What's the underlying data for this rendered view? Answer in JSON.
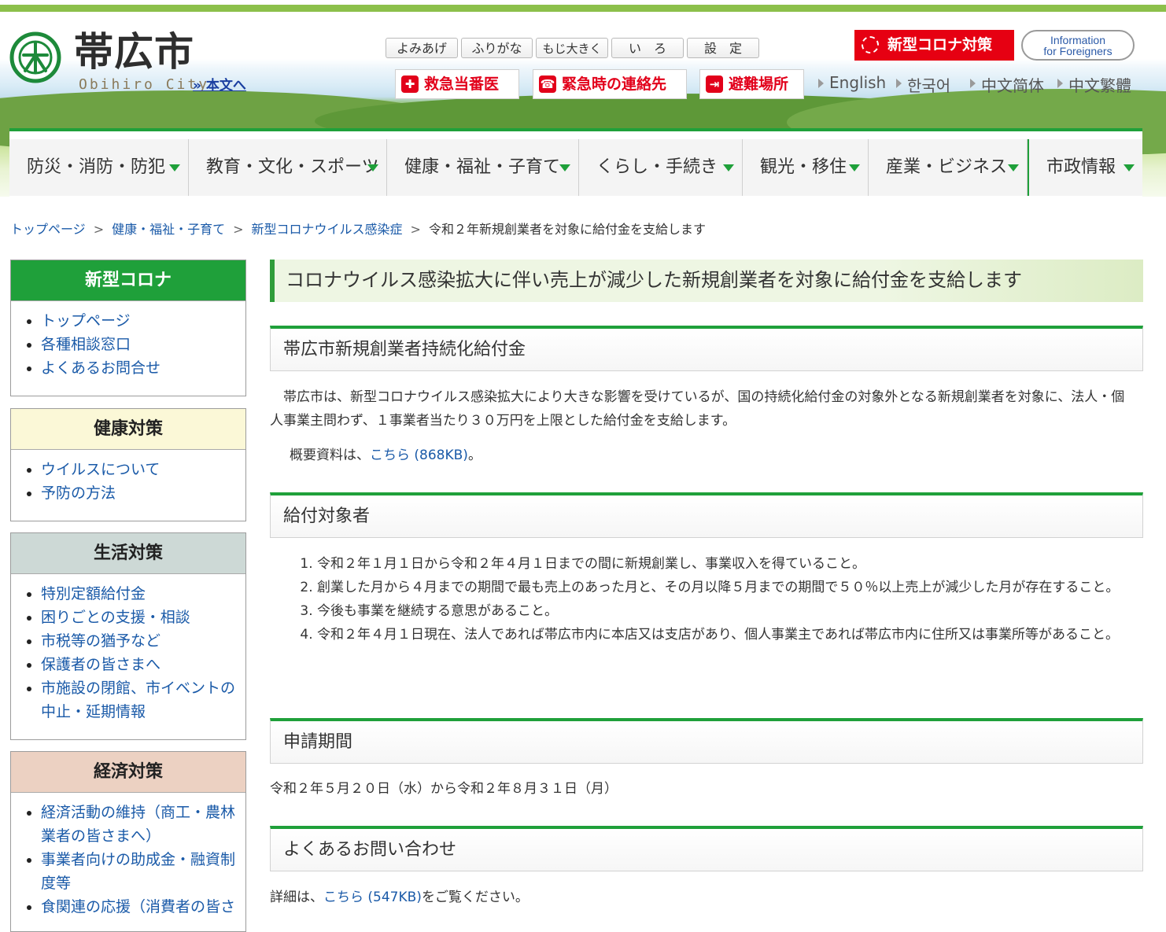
{
  "header": {
    "site_title": "帯広市",
    "site_sub": "Obihiro City",
    "skip_link": "» 本文へ",
    "tools": [
      "よみあげ",
      "ふりがな",
      "もじ大きく",
      "い　ろ",
      "設　定"
    ],
    "covid_button": "新型コロナ対策",
    "foreign_line1": "Information",
    "foreign_line2": "for Foreigners",
    "emergency": [
      "救急当番医",
      "緊急時の連絡先",
      "避難場所"
    ],
    "languages": [
      "English",
      "한국어",
      "中文简体",
      "中文繁體"
    ]
  },
  "global_nav": [
    "防災・消防・防犯",
    "教育・文化・スポーツ",
    "健康・福祉・子育て",
    "くらし・手続き",
    "観光・移住",
    "産業・ビジネス",
    "市政情報"
  ],
  "breadcrumb": {
    "links": [
      "トップページ",
      "健康・福祉・子育て",
      "新型コロナウイルス感染症"
    ],
    "current": "令和２年新規創業者を対象に給付金を支給します",
    "separator": ">"
  },
  "sidebar": [
    {
      "title": "新型コロナ",
      "items": [
        "トップページ",
        "各種相談窓口",
        "よくあるお問合せ"
      ]
    },
    {
      "title": "健康対策",
      "items": [
        "ウイルスについて",
        "予防の方法"
      ]
    },
    {
      "title": "生活対策",
      "items": [
        "特別定額給付金",
        "困りごとの支援・相談",
        "市税等の猶予など",
        "保護者の皆さまへ",
        "市施設の閉館、市イベントの中止・延期情報"
      ]
    },
    {
      "title": "経済対策",
      "items": [
        "経済活動の維持（商工・農林業者の皆さまへ）",
        "事業者向けの助成金・融資制度等",
        "食関連の応援（消費者の皆さ"
      ]
    }
  ],
  "main": {
    "title": "コロナウイルス感染拡大に伴い売上が減少した新規創業者を対象に給付金を支給します",
    "sec1_heading": "帯広市新規創業者持続化給付金",
    "sec1_text": "帯広市は、新型コロナウイルス感染拡大により大きな影響を受けているが、国の持続化給付金の対象外となる新規創業者を対象に、法人・個人事業主問わず、１事業者当たり３０万円を上限とした給付金を支給します。",
    "sec1_overview_prefix": "概要資料は、",
    "sec1_overview_link": "こちら (868KB)",
    "sec1_overview_suffix": "。",
    "sec2_heading": "給付対象者",
    "sec2_items": [
      "令和２年１月１日から令和２年４月１日までの間に新規創業し、事業収入を得ていること。",
      "創業した月から４月までの期間で最も売上のあった月と、その月以降５月までの期間で５０％以上売上が減少した月が存在すること。",
      "今後も事業を継続する意思があること。",
      "令和２年４月１日現在、法人であれば帯広市内に本店又は支店があり、個人事業主であれば帯広市内に住所又は事業所等があること。"
    ],
    "sec3_heading": "申請期間",
    "sec3_text": "令和２年５月２０日（水）から令和２年８月３１日（月）",
    "sec4_heading": "よくあるお問い合わせ",
    "sec4_prefix": "詳細は、",
    "sec4_link": "こちら (547KB)",
    "sec4_suffix": "をご覧ください。"
  },
  "colors": {
    "accent_green": "#1fa03a",
    "emergency_red": "#e2001a",
    "link_blue": "#1a5aa8"
  },
  "icons": {
    "logo": "obihiro-city-emblem",
    "covid": "virus-icon",
    "emergency": [
      "plus-cross-icon",
      "phone-icon",
      "evacuation-icon"
    ]
  }
}
